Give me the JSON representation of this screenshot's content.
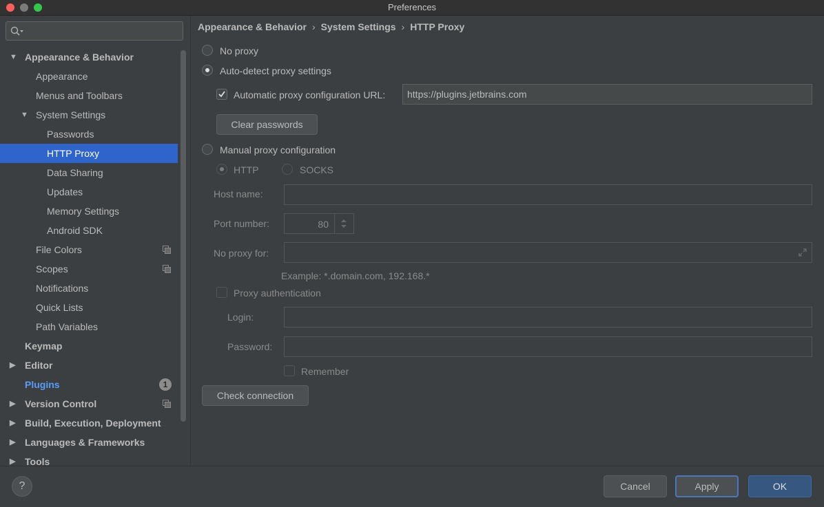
{
  "window": {
    "title": "Preferences"
  },
  "sidebar": {
    "search_placeholder": "",
    "items": [
      {
        "label": "Appearance & Behavior",
        "expanded": true
      },
      {
        "label": "Appearance"
      },
      {
        "label": "Menus and Toolbars"
      },
      {
        "label": "System Settings",
        "expanded": true
      },
      {
        "label": "Passwords"
      },
      {
        "label": "HTTP Proxy",
        "selected": true
      },
      {
        "label": "Data Sharing"
      },
      {
        "label": "Updates"
      },
      {
        "label": "Memory Settings"
      },
      {
        "label": "Android SDK"
      },
      {
        "label": "File Colors",
        "icon": "copy-icon"
      },
      {
        "label": "Scopes",
        "icon": "copy-icon"
      },
      {
        "label": "Notifications"
      },
      {
        "label": "Quick Lists"
      },
      {
        "label": "Path Variables"
      },
      {
        "label": "Keymap"
      },
      {
        "label": "Editor",
        "expanded": false
      },
      {
        "label": "Plugins",
        "badge": "1"
      },
      {
        "label": "Version Control",
        "expanded": false,
        "icon": "copy-icon"
      },
      {
        "label": "Build, Execution, Deployment",
        "expanded": false
      },
      {
        "label": "Languages & Frameworks",
        "expanded": false
      },
      {
        "label": "Tools",
        "expanded": false
      }
    ]
  },
  "breadcrumb": [
    "Appearance & Behavior",
    "System Settings",
    "HTTP Proxy"
  ],
  "proxy": {
    "no_proxy_label": "No proxy",
    "auto_detect_label": "Auto-detect proxy settings",
    "auto_config_url_label": "Automatic proxy configuration URL:",
    "auto_config_url_value": "https://plugins.jetbrains.com",
    "clear_passwords_label": "Clear passwords",
    "manual_label": "Manual proxy configuration",
    "http_label": "HTTP",
    "socks_label": "SOCKS",
    "host_name_label": "Host name:",
    "host_name_value": "",
    "port_number_label": "Port number:",
    "port_number_value": "80",
    "no_proxy_for_label": "No proxy for:",
    "no_proxy_for_value": "",
    "example_hint": "Example: *.domain.com, 192.168.*",
    "proxy_auth_label": "Proxy authentication",
    "login_label": "Login:",
    "login_value": "",
    "password_label": "Password:",
    "password_value": "",
    "remember_label": "Remember",
    "check_connection_label": "Check connection"
  },
  "footer": {
    "help_label": "?",
    "cancel_label": "Cancel",
    "apply_label": "Apply",
    "ok_label": "OK"
  },
  "colors": {
    "background": "#3c3f41",
    "selection": "#2f65ca",
    "link": "#589df6",
    "primary_button": "#365880"
  }
}
